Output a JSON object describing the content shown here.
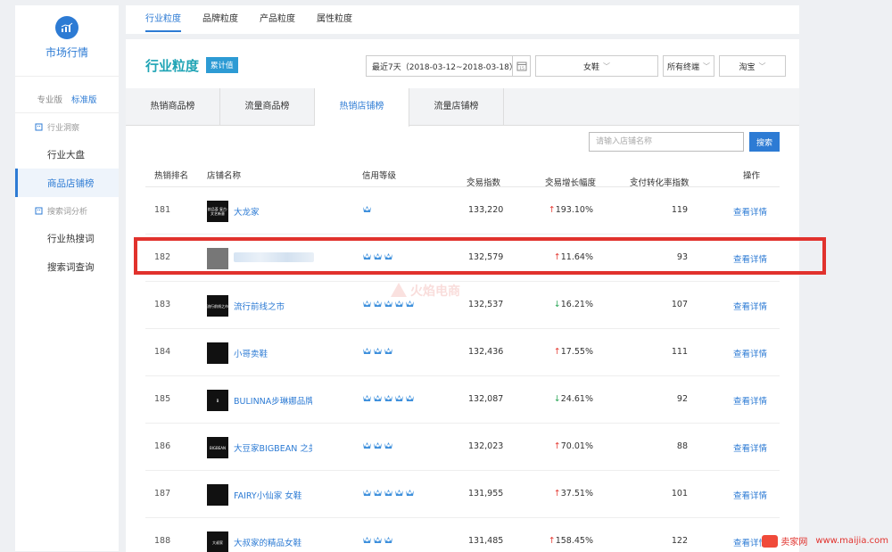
{
  "sidebar": {
    "title": "市场行情",
    "versions": [
      "专业版",
      "标准版"
    ],
    "groups": [
      {
        "label": "行业洞察",
        "items": [
          "行业大盘",
          "商品店铺榜"
        ]
      },
      {
        "label": "搜索词分析",
        "items": [
          "行业热搜词",
          "搜索词查询"
        ]
      }
    ]
  },
  "top_tabs": [
    "行业粒度",
    "品牌粒度",
    "产品粒度",
    "属性粒度"
  ],
  "header": {
    "title": "行业粒度",
    "badge": "累计值",
    "date_range": "最近7天（2018-03-12~2018-03-18）",
    "calendar_day": "15",
    "category": "女鞋",
    "terminal": "所有终端",
    "platform": "淘宝"
  },
  "sub_tabs": [
    "热销商品榜",
    "流量商品榜",
    "热销店铺榜",
    "流量店铺榜"
  ],
  "search": {
    "placeholder": "请输入店铺名称",
    "button": "搜索"
  },
  "table": {
    "headers": {
      "rank": "热销排名",
      "name": "店铺名称",
      "credit": "信用等级",
      "trade": "交易指数",
      "growth": "交易增长幅度",
      "conversion": "支付转化率指数",
      "action": "操作"
    },
    "rows": [
      {
        "rank": "181",
        "logo": "韵品荟 复古·文艺新意",
        "name": "大龙家",
        "crowns": 1,
        "trade": "133,220",
        "dir": "up",
        "growth": "193.10%",
        "conversion": "119",
        "action": "查看详情"
      },
      {
        "rank": "182",
        "logo": "",
        "name": "",
        "crowns": 3,
        "trade": "132,579",
        "dir": "up",
        "growth": "11.64%",
        "conversion": "93",
        "action": "查看详情"
      },
      {
        "rank": "183",
        "logo": "流行前线之市",
        "name": "流行前线之市",
        "crowns": 5,
        "trade": "132,537",
        "dir": "down",
        "growth": "16.21%",
        "conversion": "107",
        "action": "查看详情"
      },
      {
        "rank": "184",
        "logo": "",
        "name": "小哥卖鞋",
        "crowns": 3,
        "trade": "132,436",
        "dir": "up",
        "growth": "17.55%",
        "conversion": "111",
        "action": "查看详情"
      },
      {
        "rank": "185",
        "logo": "B",
        "name": "BULINNA步琳娜品牌店",
        "crowns": 5,
        "trade": "132,087",
        "dir": "down",
        "growth": "24.61%",
        "conversion": "92",
        "action": "查看详情"
      },
      {
        "rank": "186",
        "logo": "BIGBEAN",
        "name": "大豆家BIGBEAN 之美鞋",
        "crowns": 3,
        "trade": "132,023",
        "dir": "up",
        "growth": "70.01%",
        "conversion": "88",
        "action": "查看详情"
      },
      {
        "rank": "187",
        "logo": "",
        "name": "FAIRY小仙家 女鞋",
        "crowns": 5,
        "trade": "131,955",
        "dir": "up",
        "growth": "37.51%",
        "conversion": "101",
        "action": "查看详情"
      },
      {
        "rank": "188",
        "logo": "大叔家",
        "name": "大叔家的精品女鞋",
        "crowns": 3,
        "trade": "131,485",
        "dir": "up",
        "growth": "158.45%",
        "conversion": "122",
        "action": "查看详情"
      }
    ]
  },
  "watermark": {
    "center": "火焰电商",
    "corner_brand": "卖家网",
    "corner_url": "www.maijia.com"
  },
  "colors": {
    "accent": "#2d7bd4",
    "title": "#1fa4b5",
    "up": "#e5413a",
    "down": "#2fa85a",
    "highlight": "#e1322d"
  }
}
